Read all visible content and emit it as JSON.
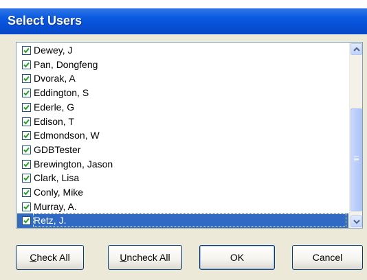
{
  "dialog": {
    "title": "Select Users"
  },
  "users": [
    {
      "name": "Dewey, J",
      "checked": true
    },
    {
      "name": "Pan, Dongfeng",
      "checked": true
    },
    {
      "name": "Dvorak, A",
      "checked": true
    },
    {
      "name": "Eddington, S",
      "checked": true
    },
    {
      "name": "Ederle, G",
      "checked": true
    },
    {
      "name": "Edison, T",
      "checked": true
    },
    {
      "name": "Edmondson, W",
      "checked": true
    },
    {
      "name": "GDBTester",
      "checked": true
    },
    {
      "name": "Brewington, Jason",
      "checked": true
    },
    {
      "name": "Clark, Lisa",
      "checked": true
    },
    {
      "name": "Conly, Mike",
      "checked": true
    },
    {
      "name": "Murray, A.",
      "checked": true
    },
    {
      "name": "Retz, J.",
      "checked": true,
      "selected": true
    }
  ],
  "buttons": {
    "check_all": {
      "mnemonic": "C",
      "rest": "heck All"
    },
    "uncheck_all": {
      "mnemonic": "U",
      "rest": "ncheck All"
    },
    "ok": "OK",
    "cancel": "Cancel"
  },
  "colors": {
    "titlebar": "#0650d8",
    "selection": "#316ac5",
    "dialog_bg": "#ece9d8"
  }
}
